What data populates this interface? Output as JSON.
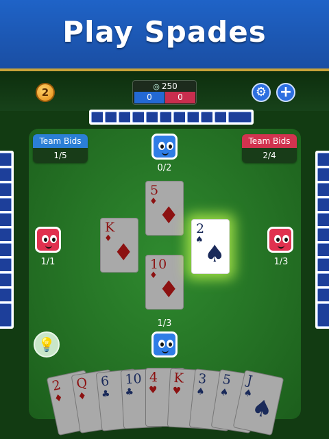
{
  "banner": {
    "title": "Play Spades"
  },
  "topbar": {
    "level": "2",
    "target_score": "250",
    "team_blue_score": "0",
    "team_red_score": "0",
    "settings_icon": "gear-icon",
    "add_icon": "plus-icon"
  },
  "team_bids": {
    "left": {
      "label": "Team Bids",
      "value": "1/5",
      "color": "#2b7fd6"
    },
    "right": {
      "label": "Team Bids",
      "value": "2/4",
      "color": "#d2334f"
    }
  },
  "players": {
    "top": {
      "bid": "0/2"
    },
    "left": {
      "bid": "1/1"
    },
    "right": {
      "bid": "1/3"
    },
    "bottom": {
      "bid": "1/3"
    }
  },
  "played_cards": [
    {
      "position": "top",
      "rank": "5",
      "suit": "♦",
      "highlighted": false
    },
    {
      "position": "left",
      "rank": "K",
      "suit": "♦",
      "highlighted": false
    },
    {
      "position": "bottom",
      "rank": "10",
      "suit": "♦",
      "highlighted": false
    },
    {
      "position": "right",
      "rank": "2",
      "suit": "♠",
      "highlighted": true
    }
  ],
  "hand": [
    {
      "rank": "2",
      "suit": "♦",
      "color": "red"
    },
    {
      "rank": "Q",
      "suit": "♦",
      "color": "red"
    },
    {
      "rank": "6",
      "suit": "♣",
      "color": "black"
    },
    {
      "rank": "10",
      "suit": "♣",
      "color": "black"
    },
    {
      "rank": "4",
      "suit": "♥",
      "color": "red"
    },
    {
      "rank": "K",
      "suit": "♥",
      "color": "red"
    },
    {
      "rank": "3",
      "suit": "♠",
      "color": "black"
    },
    {
      "rank": "5",
      "suit": "♠",
      "color": "black"
    },
    {
      "rank": "J",
      "suit": "♠",
      "color": "black"
    }
  ],
  "hint_icon": "lightbulb-icon",
  "colors": {
    "accent_blue": "#2f7de6",
    "accent_red": "#e0314f",
    "felt": "#2f8a2f"
  }
}
